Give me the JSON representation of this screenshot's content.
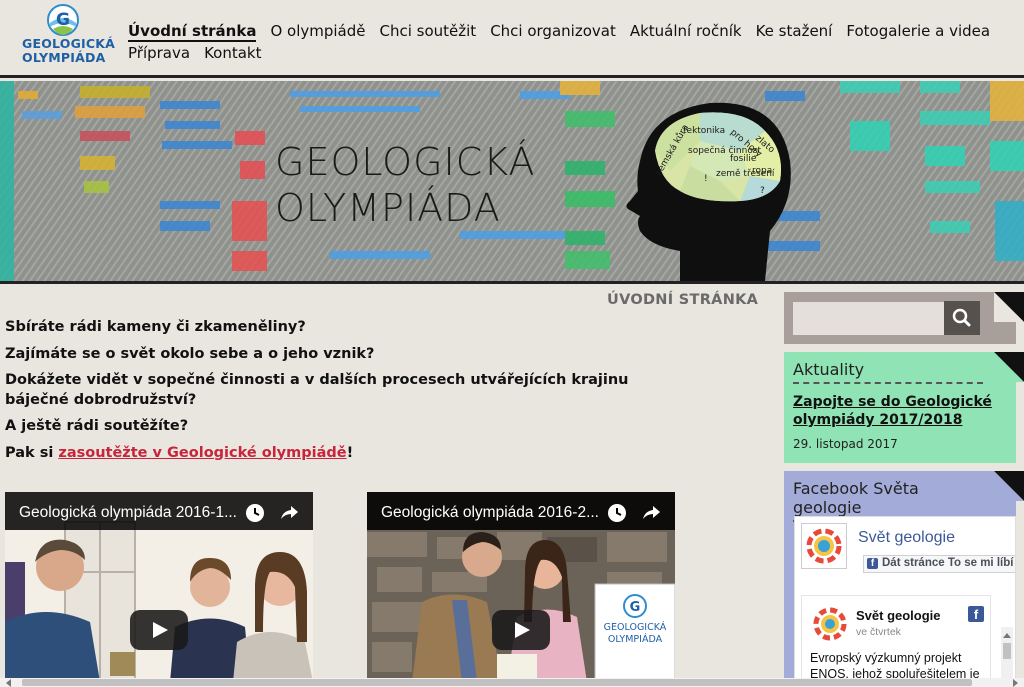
{
  "header": {
    "logo_line1": "GEOLOGICKÁ",
    "logo_line2": "OLYMPIÁDA",
    "nav": [
      "Úvodní stránka",
      "O olympiádě",
      "Chci soutěžit",
      "Chci organizovat",
      "Aktuální ročník",
      "Ke stažení",
      "Fotogalerie a videa",
      "Příprava",
      "Kontakt"
    ]
  },
  "banner": {
    "title_line1": "GEOLOGICKÁ",
    "title_line2": "OLYMPIÁDA",
    "brain_words": [
      "tektonika",
      "pro hory",
      "zlato",
      "zemská kůra",
      "sopečná činnost",
      "fosilie",
      "ropa",
      "!",
      "země třesení",
      "?"
    ]
  },
  "main": {
    "page_title": "ÚVODNÍ STRÁNKA",
    "q1": "Sbíráte rádi kameny či zkameněliny?",
    "q2": "Zajímáte se o svět okolo sebe a o jeho vznik?",
    "q3": "Dokážete vidět v sopečné činnosti a v dalších procesech utvářejících krajinu báječné dobrodružství?",
    "q4": "A ještě rádi soutěžíte?",
    "cta_prefix": "Pak si ",
    "cta_link": "zasoutěžte v Geologické olympiádě",
    "cta_suffix": "!",
    "videos": [
      {
        "title": "Geologická olympiáda 2016-1..."
      },
      {
        "title": "Geologická olympiáda 2016-2..."
      }
    ],
    "video2_sign_line1": "GEOLOGICKÁ",
    "video2_sign_line2": "OLYMPIÁDA"
  },
  "sidebar": {
    "search": {
      "placeholder": ""
    },
    "news": {
      "title": "Aktuality",
      "item_link": "Zapojte se do Geologické olympiády 2017/2018",
      "item_date": "29. listopad 2017"
    },
    "facebook": {
      "title": "Facebook Světa geologie",
      "page_name": "Svět geologie",
      "like_label": "Dát stránce To se mi líbí",
      "post_author": "Svět geologie",
      "post_date": "ve čtvrtek",
      "post_text": "Evropský výzkumný projekt ENOS, jehož spoluřešitelem je"
    }
  },
  "colors": {
    "page_bg": "#e9e5df",
    "news_bg": "#8fe3b4",
    "facebook_bg": "#a3abd8",
    "search_bg": "#a89e9a",
    "link_red": "#c8253a",
    "logo_blue": "#1f5fa6"
  }
}
